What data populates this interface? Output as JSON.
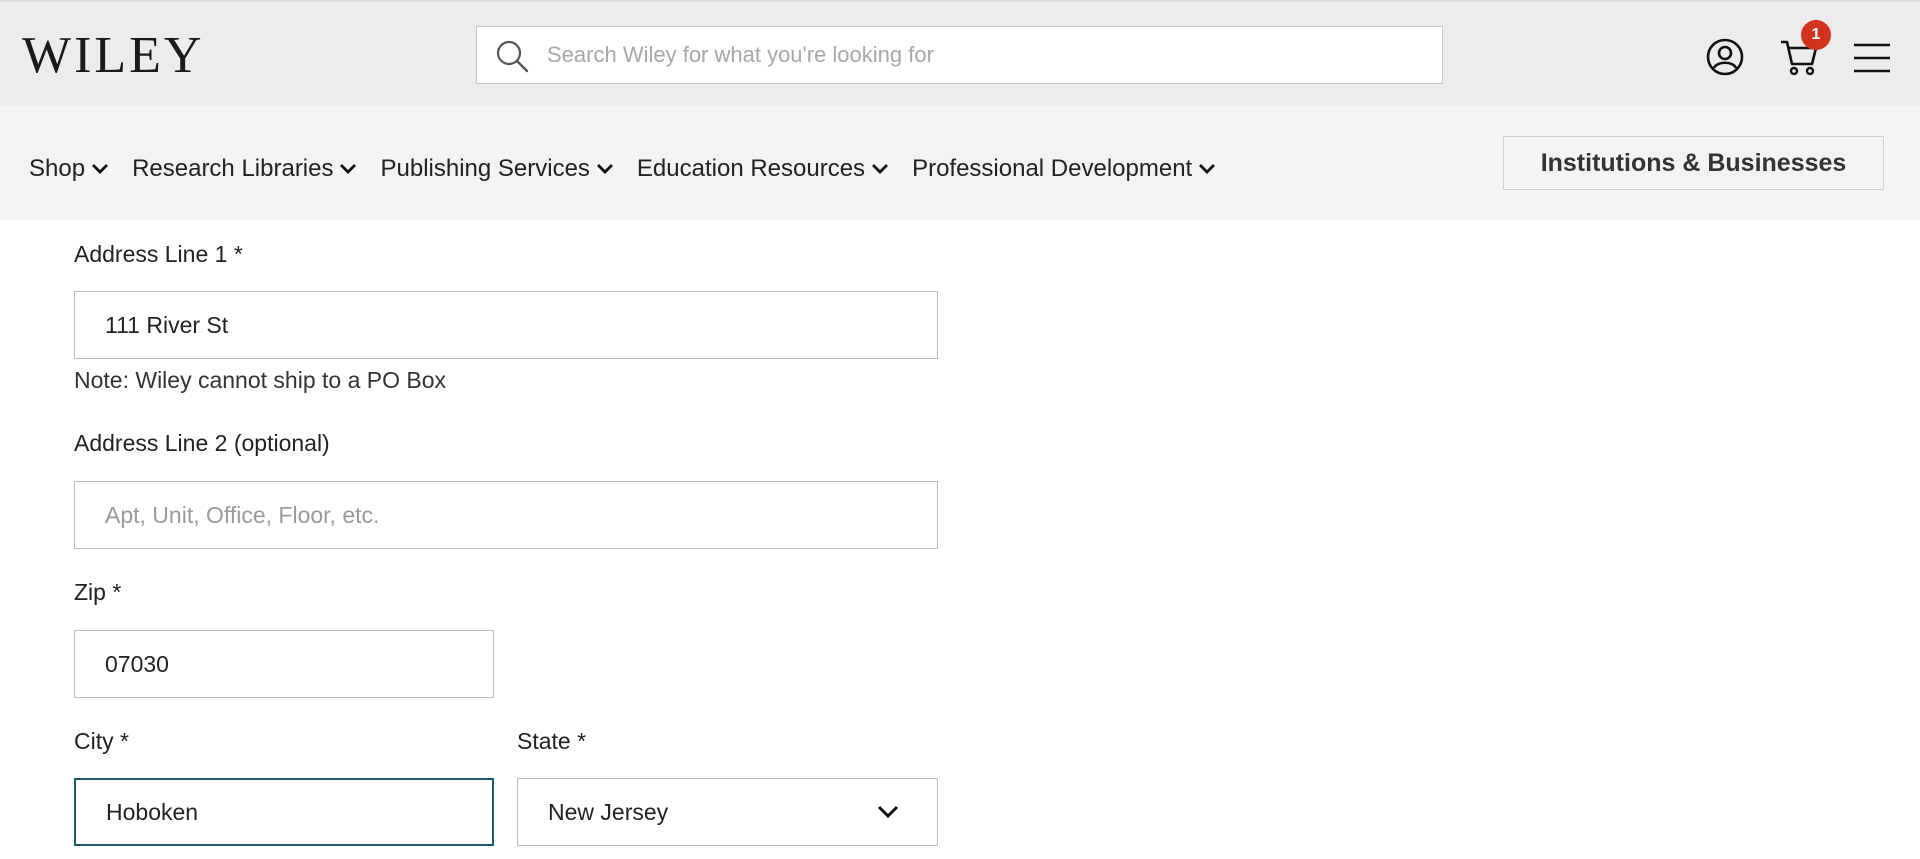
{
  "header": {
    "logo_text": "WILEY",
    "search": {
      "placeholder": "Search Wiley for what you're looking for",
      "value": ""
    },
    "cart_count": "1",
    "icons": [
      "search-icon",
      "account-icon",
      "cart-icon",
      "menu-icon"
    ]
  },
  "nav": {
    "items": [
      {
        "label": "Shop"
      },
      {
        "label": "Research Libraries"
      },
      {
        "label": "Publishing Services"
      },
      {
        "label": "Education Resources"
      },
      {
        "label": "Professional Development"
      }
    ],
    "institutions_button": "Institutions & Businesses"
  },
  "form": {
    "address1": {
      "label": "Address Line 1 *",
      "value": "111 River St"
    },
    "note": "Note: Wiley cannot ship to a PO Box",
    "address2": {
      "label": "Address Line 2 (optional)",
      "placeholder": "Apt, Unit, Office, Floor, etc.",
      "value": ""
    },
    "zip": {
      "label": "Zip *",
      "value": "07030"
    },
    "city": {
      "label": "City *",
      "value": "Hoboken"
    },
    "state": {
      "label": "State *",
      "value": "New Jersey"
    }
  },
  "colors": {
    "header_bg": "#ececec",
    "nav_bg": "#f3f3f3",
    "badge": "#d2331f",
    "focus_border": "#1f5a6e"
  }
}
